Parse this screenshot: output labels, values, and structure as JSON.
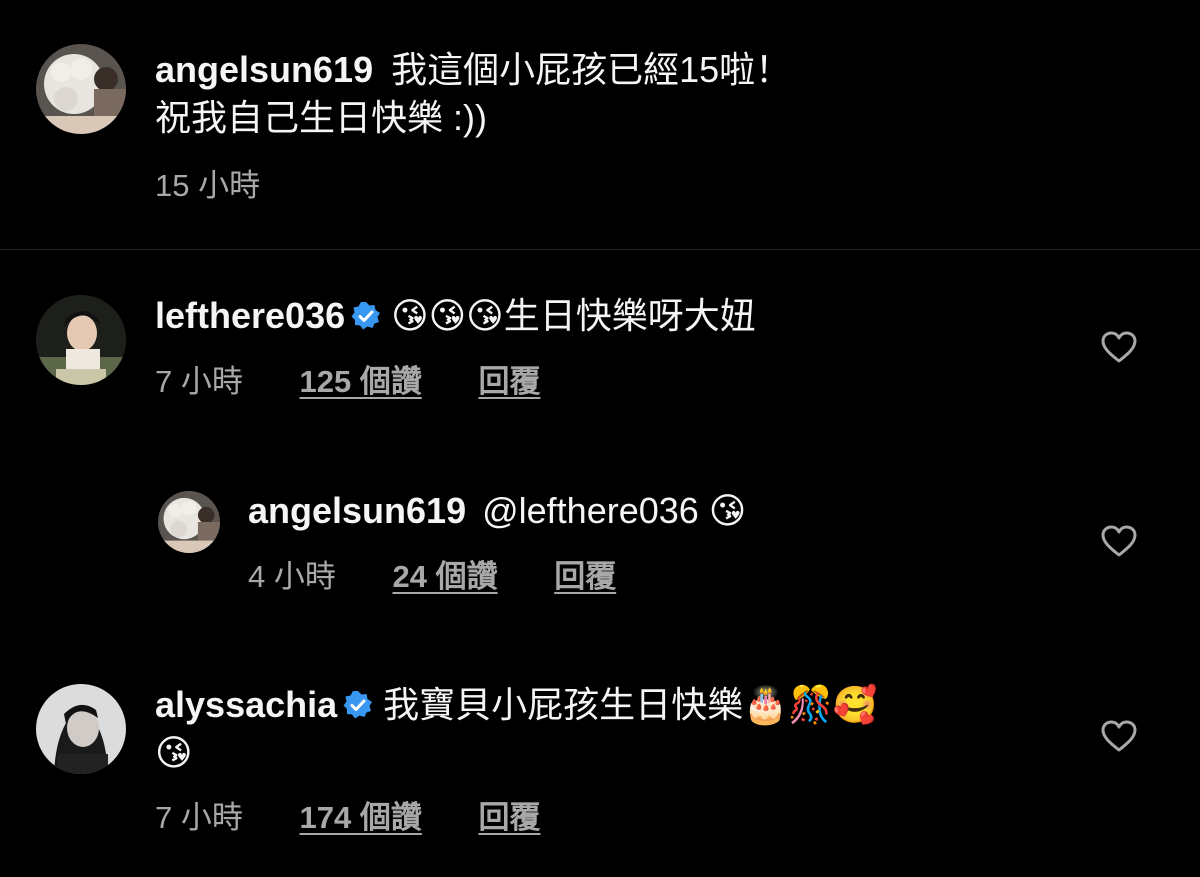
{
  "caption": {
    "username": "angelsun619",
    "text_line1": "我這個小屁孩已經15啦！",
    "text_line2": "祝我自己生日快樂 :))",
    "time": "15 小時"
  },
  "comments": [
    {
      "username": "lefthere036",
      "verified": true,
      "text": "😘😘😘生日快樂呀大妞",
      "time": "7 小時",
      "likes": "125 個讚",
      "reply": "回覆"
    },
    {
      "username": "angelsun619",
      "verified": false,
      "text": "@lefthere036 😘",
      "time": "4 小時",
      "likes": "24 個讚",
      "reply": "回覆"
    },
    {
      "username": "alyssachia",
      "verified": true,
      "text_line1": "我寶貝小屁孩生日快樂🎂🎊🥰",
      "text_line2": "😘",
      "time": "7 小時",
      "likes": "174 個讚",
      "reply": "回覆"
    }
  ],
  "colors": {
    "background": "#000000",
    "text": "#f5f5f5",
    "meta": "#a8a8a8",
    "verified": "#3897f0",
    "divider": "#262626"
  }
}
